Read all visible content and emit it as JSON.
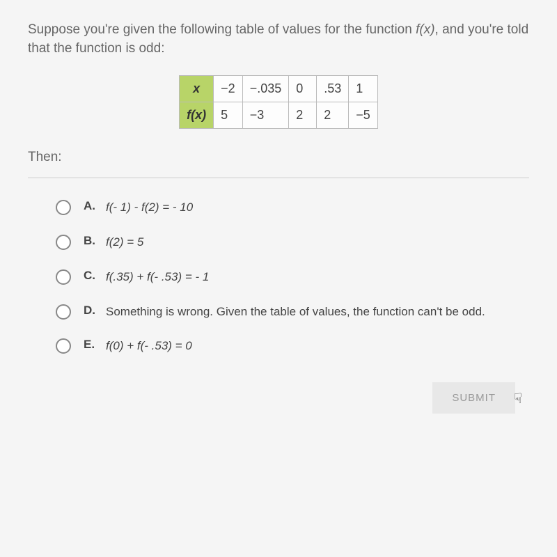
{
  "question": {
    "line1": "Suppose you're given the following table of values for the function ",
    "fx1": "f(x)",
    "line1b": ", and you're told that the function is odd:",
    "then": "Then:"
  },
  "table": {
    "header_x": "x",
    "header_fx": "f(x)",
    "row1": [
      "−2",
      "−.035",
      "0",
      ".53",
      "1"
    ],
    "row2": [
      "5",
      "−3",
      "2",
      "2",
      "−5"
    ]
  },
  "options": {
    "a": {
      "label": "A.",
      "text": "f(- 1) - f(2) = - 10"
    },
    "b": {
      "label": "B.",
      "text": "f(2) = 5"
    },
    "c": {
      "label": "C.",
      "text": "f(.35) + f(- .53) = - 1"
    },
    "d": {
      "label": "D.",
      "text": "Something is wrong. Given the table of values, the function can't be odd."
    },
    "e": {
      "label": "E.",
      "text": "f(0) + f(- .53) = 0"
    }
  },
  "submit": "SUBMIT"
}
